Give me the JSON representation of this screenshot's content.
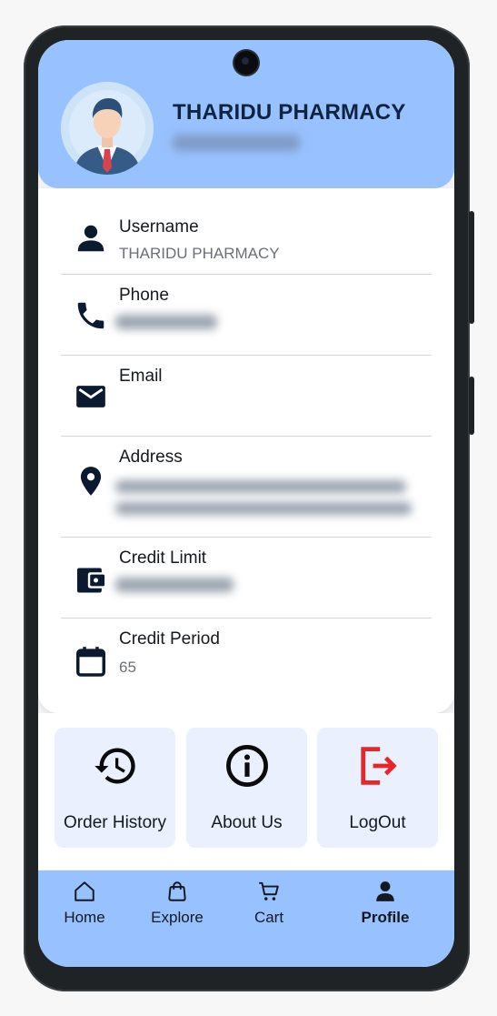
{
  "header": {
    "store_name": "THARIDU PHARMACY"
  },
  "profile_fields": [
    {
      "label": "Username",
      "value": "THARIDU PHARMACY",
      "icon": "person-icon"
    },
    {
      "label": "Phone",
      "value": "",
      "icon": "phone-icon"
    },
    {
      "label": "Email",
      "value": "",
      "icon": "mail-icon"
    },
    {
      "label": "Address",
      "value": "",
      "icon": "location-pin-icon"
    },
    {
      "label": "Credit Limit",
      "value": "",
      "icon": "wallet-icon"
    },
    {
      "label": "Credit Period",
      "value": "65",
      "icon": "calendar-icon"
    }
  ],
  "actions": [
    {
      "label": "Order History",
      "icon": "history-icon"
    },
    {
      "label": "About Us",
      "icon": "info-icon"
    },
    {
      "label": "LogOut",
      "icon": "logout-icon"
    }
  ],
  "nav": [
    {
      "label": "Home",
      "icon": "home-icon"
    },
    {
      "label": "Explore",
      "icon": "shopping-bag-icon"
    },
    {
      "label": "Cart",
      "icon": "cart-icon"
    },
    {
      "label": "Profile",
      "icon": "profile-icon",
      "active": true
    }
  ],
  "colors": {
    "header_bg": "#98c2ff",
    "tile_bg": "#eaf0fe",
    "logout_red": "#e5262b",
    "text_dark": "#15191e"
  }
}
